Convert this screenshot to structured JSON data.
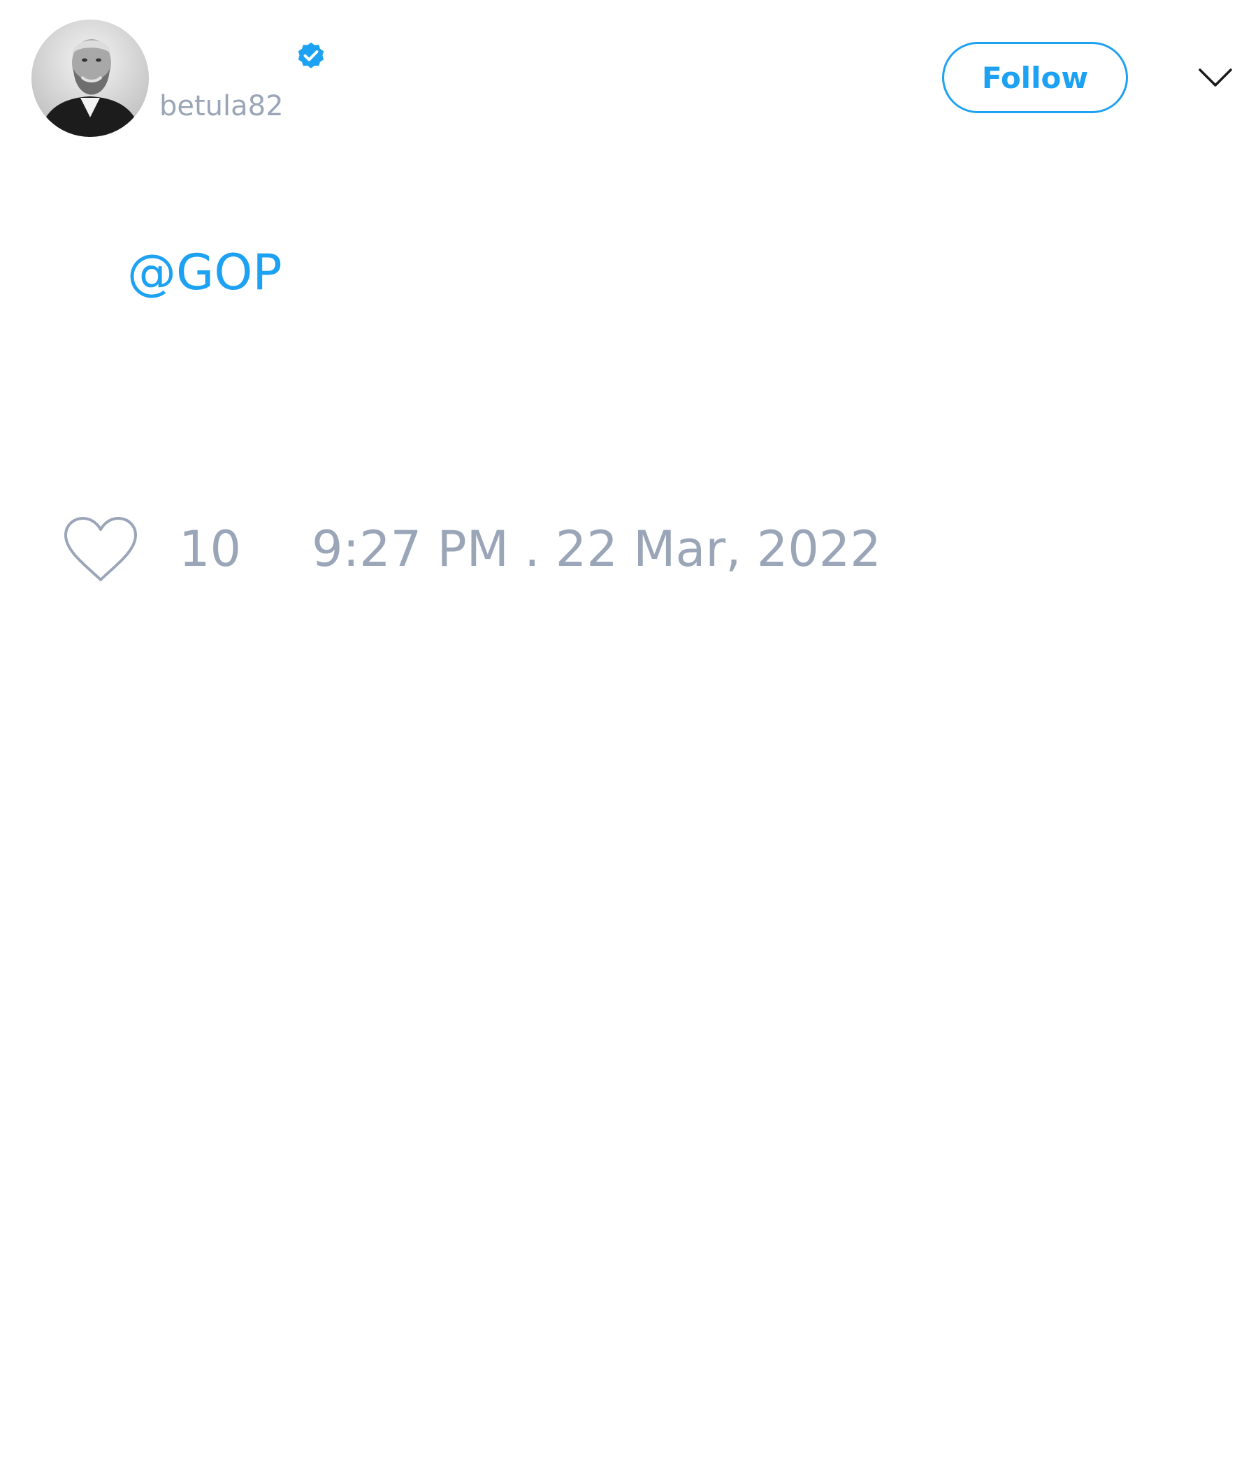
{
  "tweet": {
    "author": {
      "display_name": "",
      "handle": "betula82",
      "verified": true,
      "avatar_icon": "bearded-man-portrait"
    },
    "follow_label": "Follow",
    "menu_icon": "chevron-down-icon",
    "text": "@GOP",
    "likes": "10",
    "like_icon": "heart-icon",
    "timestamp": "9:27 PM . 22 Mar, 2022"
  },
  "colors": {
    "accent": "#1da1f2",
    "muted": "#9aa6b8",
    "background": "#ffffff"
  }
}
